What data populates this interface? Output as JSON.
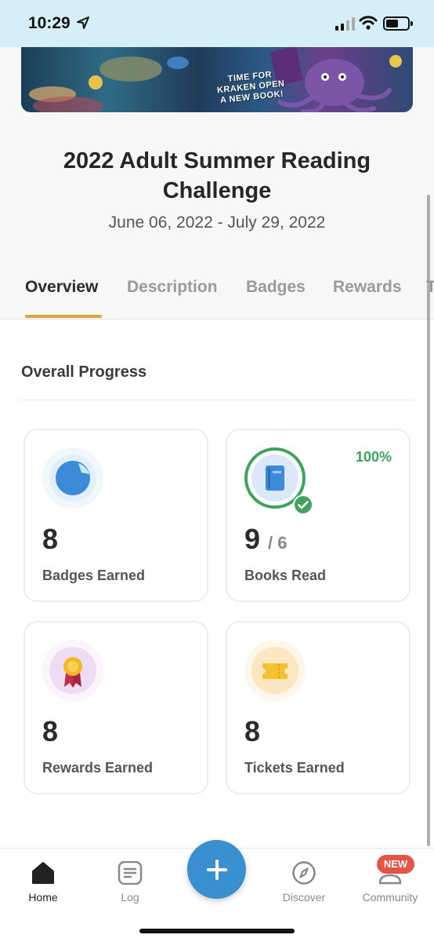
{
  "status_bar": {
    "time": "10:29"
  },
  "banner": {
    "lines": [
      "TIME FOR",
      "KRAKEN OPEN",
      "A NEW BOOK!"
    ]
  },
  "challenge": {
    "title": "2022 Adult Summer Reading Challenge",
    "dates": "June 06, 2022 - July 29, 2022"
  },
  "tabs": [
    {
      "label": "Overview",
      "active": true
    },
    {
      "label": "Description"
    },
    {
      "label": "Badges"
    },
    {
      "label": "Rewards"
    },
    {
      "label": "T"
    }
  ],
  "overview": {
    "section_title": "Overall Progress",
    "cards": [
      {
        "value": "8",
        "label": "Badges Earned",
        "icon": "badge-icon"
      },
      {
        "value": "9",
        "of": "/ 6",
        "label": "Books Read",
        "percent": "100%",
        "progress": 1.0,
        "icon": "book-icon"
      },
      {
        "value": "8",
        "label": "Rewards Earned",
        "icon": "award-ribbon-icon"
      },
      {
        "value": "8",
        "label": "Tickets Earned",
        "icon": "ticket-icon"
      }
    ]
  },
  "bottom_nav": {
    "items": [
      {
        "label": "Home",
        "icon": "home-icon",
        "active": true
      },
      {
        "label": "Log",
        "icon": "log-icon"
      },
      {
        "label": "Discover",
        "icon": "compass-icon"
      },
      {
        "label": "Community",
        "icon": "community-icon",
        "badge": "NEW"
      }
    ],
    "fab_icon": "plus-icon"
  },
  "colors": {
    "accent": "#d8a83f",
    "success": "#3fa35e",
    "fab": "#3a8fce",
    "new_badge": "#e2564a"
  }
}
